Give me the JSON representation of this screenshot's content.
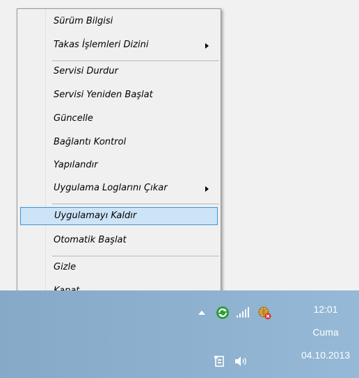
{
  "menu": {
    "items": [
      {
        "label": "Sürüm Bilgisi"
      },
      {
        "label": "Takas İşlemleri Dizini",
        "submenu": true
      },
      {
        "label": "Servisi Durdur"
      },
      {
        "label": "Servisi Yeniden Başlat"
      },
      {
        "label": "Güncelle"
      },
      {
        "label": "Bağlantı Kontrol"
      },
      {
        "label": "Yapılandır"
      },
      {
        "label": "Uygulama Loglarını Çıkar",
        "submenu": true
      },
      {
        "label": "Uygulamayı Kaldır",
        "highlighted": true
      },
      {
        "label": "Otomatik Başlat"
      },
      {
        "label": "Gizle"
      },
      {
        "label": "Kapat"
      }
    ]
  },
  "tray": {
    "icons": [
      "show-hidden-icons-arrow",
      "sync-app-icon",
      "signal-bars-icon",
      "network-error-icon",
      "action-center-icon",
      "volume-icon"
    ],
    "clock": {
      "time": "12:01",
      "day": "Cuma",
      "date": "04.10.2013"
    }
  },
  "colors": {
    "taskbar": "#8db1cf",
    "highlight": "#cce4f7",
    "highlight_border": "#3c93d8"
  }
}
